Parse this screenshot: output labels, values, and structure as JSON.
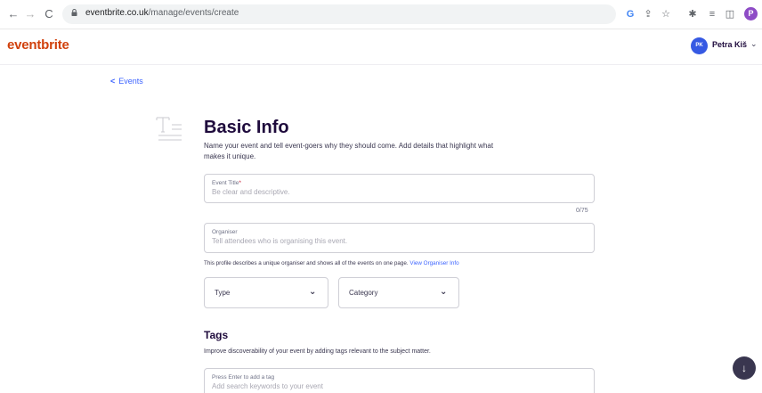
{
  "browser": {
    "url_domain": "eventbrite.co.uk",
    "url_path": "/manage/events/create",
    "back_icon": "←",
    "forward_icon": "→",
    "reload_icon": "C",
    "toolbar_icons": [
      "G",
      "⇪",
      "☆",
      "✱",
      "≡",
      "◫"
    ],
    "profile_initial": "P"
  },
  "header": {
    "logo": "eventbrite",
    "user_initials": "PK",
    "user_name": "Petra Kiš",
    "user_chevron": "⌄"
  },
  "back_link": {
    "chevron": "<",
    "label": "Events"
  },
  "basic_info": {
    "title": "Basic Info",
    "description": "Name your event and tell event-goers why they should come. Add details that highlight what makes it unique."
  },
  "event_title_field": {
    "label": "Event Title",
    "required_mark": "*",
    "placeholder": "Be clear and descriptive.",
    "counter": "0/75"
  },
  "organiser_field": {
    "label": "Organiser",
    "placeholder": "Tell attendees who is organising this event.",
    "helper": "This profile describes a unique organiser and shows all of the events on one page.",
    "helper_link": "View Organiser Info"
  },
  "type_select": {
    "label": "Type",
    "chevron": "⌄"
  },
  "category_select": {
    "label": "Category",
    "chevron": "⌄"
  },
  "tags": {
    "title": "Tags",
    "description": "Improve discoverability of your event by adding tags relevant to the subject matter.",
    "field_label": "Press Enter to add a tag",
    "placeholder": "Add search keywords to your event"
  },
  "scroll_button": {
    "icon": "↓"
  },
  "colors": {
    "brand": "#d1410c",
    "link": "#3d64ff",
    "heading": "#1e0a3c",
    "avatar": "#3659e3",
    "fab": "#39364f"
  }
}
